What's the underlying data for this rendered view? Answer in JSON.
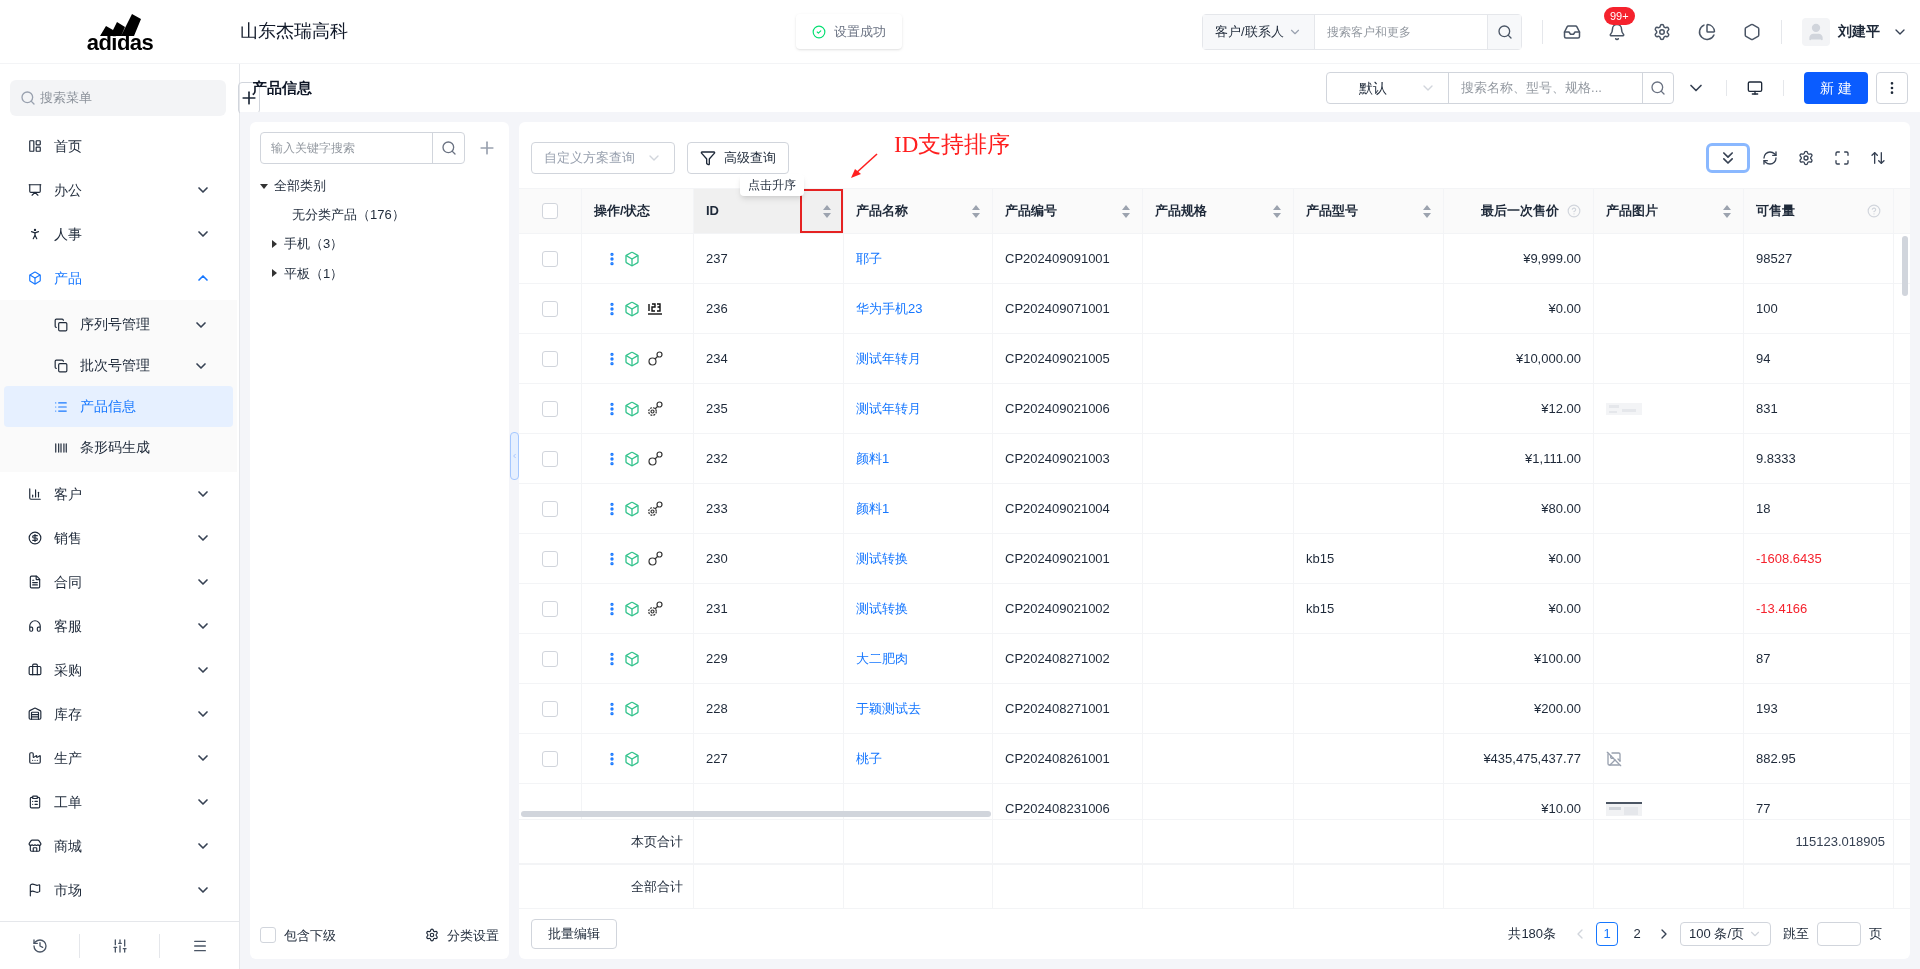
{
  "header": {
    "logo_text": "adidas",
    "company": "山东杰瑞高科",
    "toast": "设置成功",
    "search_scope": "客户/联系人",
    "search_placeholder": "搜索客户和更多",
    "badge": "99+",
    "user": "刘建平"
  },
  "sidebar": {
    "search_placeholder": "搜索菜单",
    "items": [
      {
        "label": "首页",
        "kind": "link",
        "selected": false
      },
      {
        "label": "办公",
        "kind": "group",
        "expanded": false,
        "selected": false
      },
      {
        "label": "人事",
        "kind": "group",
        "expanded": false,
        "selected": false
      },
      {
        "label": "产品",
        "kind": "group",
        "expanded": true,
        "selected": true,
        "children": [
          {
            "label": "序列号管理",
            "kind": "group",
            "expanded": false,
            "selected": false
          },
          {
            "label": "批次号管理",
            "kind": "group",
            "expanded": false,
            "selected": false
          },
          {
            "label": "产品信息",
            "kind": "link",
            "selected": true
          },
          {
            "label": "条形码生成",
            "kind": "link",
            "selected": false
          }
        ]
      },
      {
        "label": "客户",
        "kind": "group",
        "expanded": false,
        "selected": false
      },
      {
        "label": "销售",
        "kind": "group",
        "expanded": false,
        "selected": false
      },
      {
        "label": "合同",
        "kind": "group",
        "expanded": false,
        "selected": false
      },
      {
        "label": "客服",
        "kind": "group",
        "expanded": false,
        "selected": false
      },
      {
        "label": "采购",
        "kind": "group",
        "expanded": false,
        "selected": false
      },
      {
        "label": "库存",
        "kind": "group",
        "expanded": false,
        "selected": false
      },
      {
        "label": "生产",
        "kind": "group",
        "expanded": false,
        "selected": false
      },
      {
        "label": "工单",
        "kind": "group",
        "expanded": false,
        "selected": false
      },
      {
        "label": "商城",
        "kind": "group",
        "expanded": false,
        "selected": false
      },
      {
        "label": "市场",
        "kind": "group",
        "expanded": false,
        "selected": false
      }
    ]
  },
  "page": {
    "title": "产品信息",
    "view_select": "默认",
    "search_placeholder": "搜索名称、型号、规格...",
    "new_button": "新 建"
  },
  "tree": {
    "search_placeholder": "输入关键字搜索",
    "nodes": [
      {
        "label": "全部类别",
        "expanded": true,
        "children": [
          {
            "label": "无分类产品（176）"
          },
          {
            "label": "手机（3）",
            "expanded": false
          },
          {
            "label": "平板（1）",
            "expanded": false
          }
        ]
      }
    ],
    "include_children": {
      "label": "包含下级",
      "checked": false
    },
    "settings_label": "分类设置"
  },
  "toolbar": {
    "scheme_select": "自定义方案查询",
    "advanced_button": "高级查询",
    "tooltip": "点击升序",
    "annotation": "ID支持排序",
    "expand_all_active": true
  },
  "table": {
    "select_all": {
      "checked": false
    },
    "columns": [
      {
        "label": "操作/状态",
        "sortable": false,
        "help": false
      },
      {
        "label": "ID",
        "sortable": true,
        "help": false,
        "highlighted": true
      },
      {
        "label": "产品名称",
        "sortable": true,
        "help": false
      },
      {
        "label": "产品编号",
        "sortable": true,
        "help": false
      },
      {
        "label": "产品规格",
        "sortable": true,
        "help": false
      },
      {
        "label": "产品型号",
        "sortable": true,
        "help": false
      },
      {
        "label": "最后一次售价",
        "sortable": false,
        "help": true
      },
      {
        "label": "产品图片",
        "sortable": true,
        "help": false
      },
      {
        "label": "可售量",
        "sortable": false,
        "help": true
      }
    ],
    "rows": [
      {
        "checked": false,
        "id": "237",
        "name": "耶子",
        "code": "CP202409091001",
        "price": "¥9,999.00",
        "qty": "98527",
        "negative": false
      },
      {
        "checked": false,
        "status": {
          "kind": "serial"
        },
        "id": "236",
        "name": "华为手机23",
        "code": "CP202409071001",
        "price": "¥0.00",
        "qty": "100",
        "negative": false
      },
      {
        "checked": false,
        "status": {
          "kind": "link"
        },
        "id": "234",
        "name": "测试年转月",
        "code": "CP202409021005",
        "price": "¥10,000.00",
        "qty": "94",
        "negative": false
      },
      {
        "checked": false,
        "status": {
          "kind": "gear"
        },
        "id": "235",
        "name": "测试年转月",
        "code": "CP202409021006",
        "price": "¥12.00",
        "image": {
          "kind": "faint"
        },
        "qty": "831",
        "negative": false
      },
      {
        "checked": false,
        "status": {
          "kind": "link"
        },
        "id": "232",
        "name": "颜料1",
        "code": "CP202409021003",
        "price": "¥1,111.00",
        "qty": "9.8333",
        "negative": false
      },
      {
        "checked": false,
        "status": {
          "kind": "gear"
        },
        "id": "233",
        "name": "颜料1",
        "code": "CP202409021004",
        "price": "¥80.00",
        "qty": "18",
        "negative": false
      },
      {
        "checked": false,
        "status": {
          "kind": "link"
        },
        "id": "230",
        "name": "测试转换",
        "code": "CP202409021001",
        "model": "kb15",
        "price": "¥0.00",
        "qty": "-1608.6435",
        "negative": true
      },
      {
        "checked": false,
        "status": {
          "kind": "gear"
        },
        "id": "231",
        "name": "测试转换",
        "code": "CP202409021002",
        "model": "kb15",
        "price": "¥0.00",
        "qty": "-13.4166",
        "negative": true
      },
      {
        "checked": false,
        "id": "229",
        "name": "大二肥肉",
        "code": "CP202408271002",
        "price": "¥100.00",
        "qty": "87",
        "negative": false
      },
      {
        "checked": false,
        "id": "228",
        "name": "于颖测试去",
        "code": "CP202408271001",
        "price": "¥200.00",
        "qty": "193",
        "negative": false
      },
      {
        "checked": false,
        "id": "227",
        "name": "桃子",
        "code": "CP202408261001",
        "price": "¥435,475,437.77",
        "image": {
          "kind": "broken"
        },
        "qty": "882.95",
        "negative": false
      },
      {
        "code": "CP202408231006",
        "price": "¥10.00",
        "image": {
          "kind": "thumb"
        },
        "qty": "77",
        "negative": false
      }
    ],
    "summary": [
      {
        "label": "本页合计",
        "qty": "115123.018905"
      },
      {
        "label": "全部合计"
      }
    ]
  },
  "footer": {
    "batch_edit": "批量编辑",
    "total": "共180条",
    "pages": [
      {
        "label": "1",
        "selected": true
      },
      {
        "label": "2",
        "selected": false
      }
    ],
    "page_size": "100 条/页",
    "jump_label": "跳至",
    "page_suffix": "页"
  }
}
